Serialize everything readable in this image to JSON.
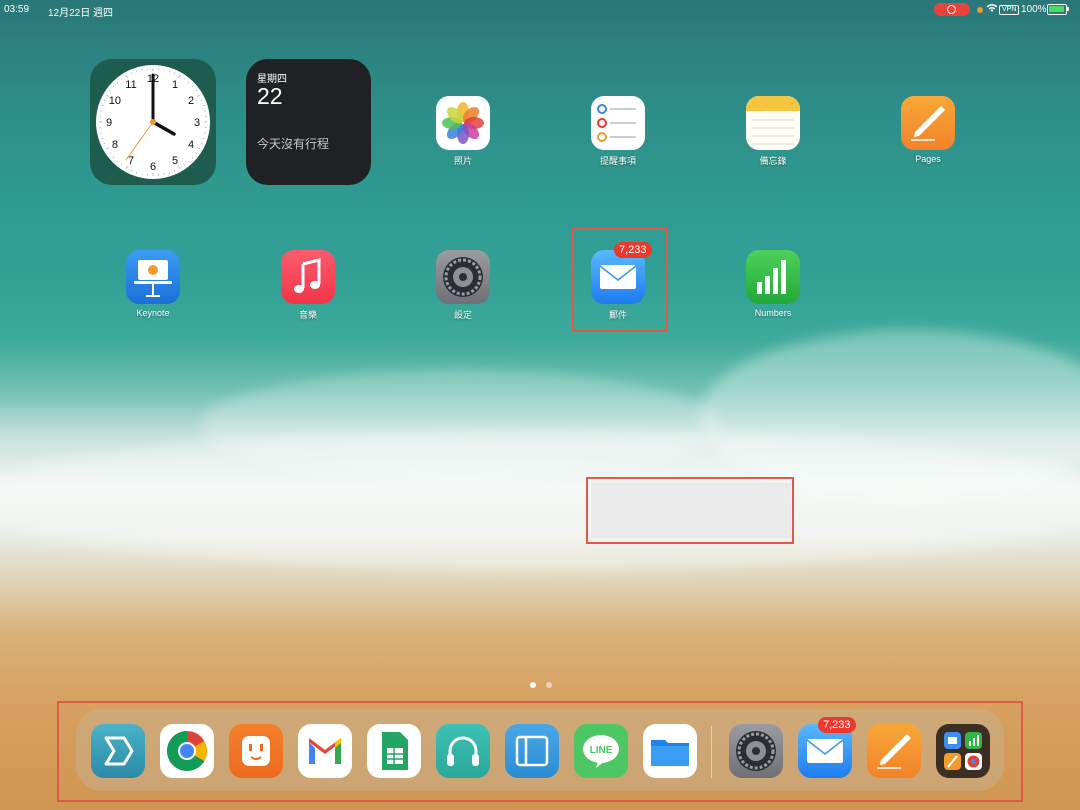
{
  "status_bar": {
    "time": "03:59",
    "date": "12月22日 週四",
    "vpn": "VPN",
    "battery": "100%"
  },
  "widgets": {
    "calendar": {
      "weekday": "星期四",
      "day": "22",
      "no_events": "今天沒有行程"
    },
    "clock": {
      "numbers": [
        "12",
        "1",
        "2",
        "3",
        "4",
        "5",
        "6",
        "7",
        "8",
        "9",
        "10",
        "11"
      ]
    }
  },
  "apps": {
    "photos": "照片",
    "reminders": "提醒事項",
    "notes": "備忘錄",
    "pages": "Pages",
    "keynote": "Keynote",
    "music": "音樂",
    "settings": "設定",
    "mail": "郵件",
    "numbers": "Numbers"
  },
  "mail_badge": "7,233",
  "dock_mail_badge": "7,233",
  "icons": {
    "dock": [
      "readdle-spark-icon",
      "chrome-icon",
      "smart-plug-icon",
      "gmail-icon",
      "google-sheets-icon",
      "headphones-icon",
      "wallet-icon",
      "line-icon",
      "files-icon",
      "settings-icon",
      "mail-icon",
      "pages-icon",
      "app-library-icon"
    ]
  },
  "colors": {
    "badge": "#ea3a30",
    "highlight": "#e05a4a"
  }
}
